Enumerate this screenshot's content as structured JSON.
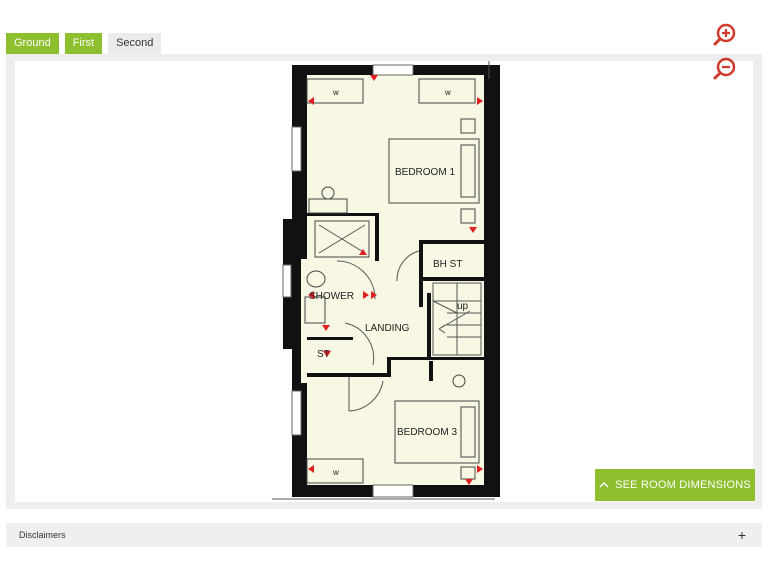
{
  "floor_tabs": [
    {
      "label": "Ground",
      "state": "available"
    },
    {
      "label": "First",
      "state": "selected"
    },
    {
      "label": "Second",
      "state": "available"
    }
  ],
  "floorplan": {
    "rooms": {
      "bedroom1": "BEDROOM 1",
      "bhst": "BH ST",
      "shower": "SHOWER",
      "landing": "LANDING",
      "st": "ST",
      "bedroom3": "BEDROOM 3",
      "up": "up"
    },
    "wardrobe_mark": "w",
    "colors": {
      "floor": "#f7f7e3",
      "wall": "#111111",
      "marker": "#e02020"
    }
  },
  "zoom": {
    "in_icon": "zoom-in-icon",
    "out_icon": "zoom-out-icon",
    "color": "#d13a2b"
  },
  "room_dimensions_button": {
    "label": "SEE ROOM DIMENSIONS",
    "icon": "chevron-up-icon",
    "color": "#8dbf2e"
  },
  "disclaimers": {
    "label": "Disclaimers",
    "toggle": "+"
  }
}
